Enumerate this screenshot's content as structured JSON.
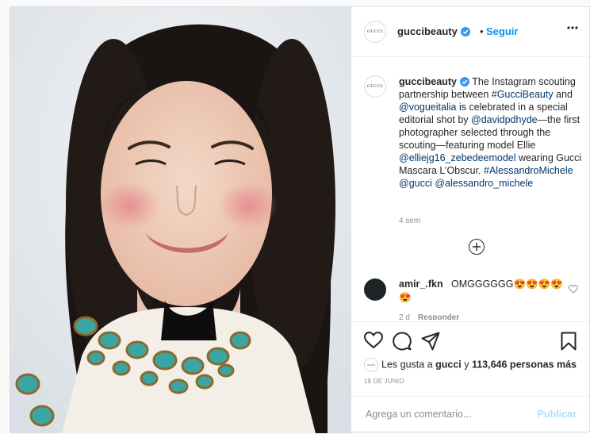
{
  "post": {
    "account": {
      "username": "guccibeauty",
      "avatar_text": "GUCCI",
      "follow_dot": "•",
      "follow_label": "Seguir"
    },
    "caption": {
      "username": "guccibeauty",
      "segments": [
        {
          "text": "The Instagram scouting partnership between ",
          "type": "text"
        },
        {
          "text": "#GucciBeauty",
          "type": "link"
        },
        {
          "text": " and ",
          "type": "text"
        },
        {
          "text": "@vogueitalia",
          "type": "link"
        },
        {
          "text": " is celebrated in a special editorial shot by ",
          "type": "text"
        },
        {
          "text": "@davidpdhyde",
          "type": "link"
        },
        {
          "text": "—the first photographer selected through the scouting—featuring model Ellie ",
          "type": "text"
        },
        {
          "text": "@elliejg16_zebedeemodel",
          "type": "link"
        },
        {
          "text": " wearing Gucci Mascara L’Obscur. ",
          "type": "text"
        },
        {
          "text": "#AlessandroMichele",
          "type": "link"
        },
        {
          "text": " ",
          "type": "text"
        },
        {
          "text": "@gucci",
          "type": "link"
        },
        {
          "text": " ",
          "type": "text"
        },
        {
          "text": "@alessandro_michele",
          "type": "link"
        }
      ],
      "time_ago": "4 sem"
    },
    "comment": {
      "username": "amir_.fkn",
      "text": "OMGGGGGG😍😍😍😍",
      "text_line2": "😍",
      "time_ago": "2 d",
      "reply_label": "Responder"
    },
    "likes": {
      "prefix": "Les gusta a ",
      "first_liker": "gucci",
      "middle": " y ",
      "count_text": "113,646 personas más"
    },
    "date": "18 DE JUNIO",
    "add_comment": {
      "placeholder": "Agrega un comentario...",
      "post_label": "Publicar"
    },
    "colors": {
      "link": "#00376b",
      "follow": "#0095f6",
      "post_disabled": "#b2dffc",
      "verified": "#3897f0"
    }
  }
}
